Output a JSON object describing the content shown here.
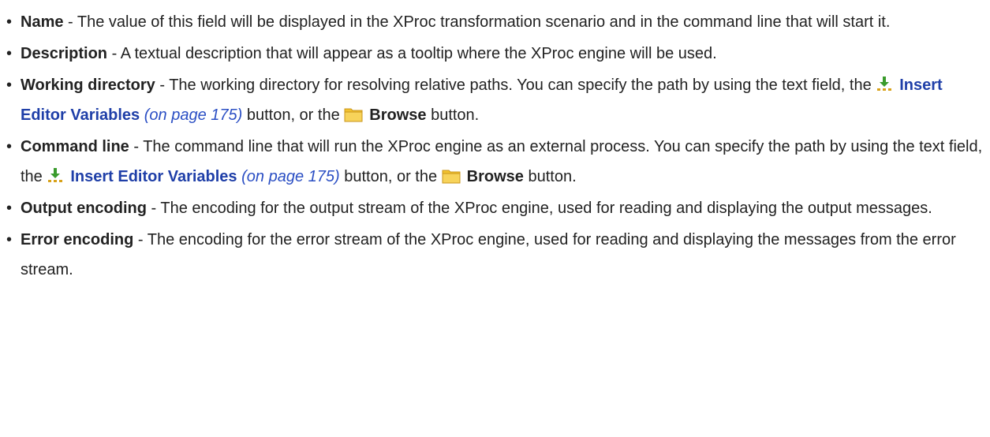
{
  "fields": [
    {
      "term": "Name",
      "desc": " - The value of this field will be displayed in the XProc transformation scenario and in the command line that will start it."
    },
    {
      "term": "Description",
      "desc": " - A textual description that will appear as a tooltip where the XProc engine will be used."
    },
    {
      "term": "Working directory",
      "desc": " - The working directory for resolving relative paths. You can specify the path by using the text field, the ",
      "insert_label": "Insert Editor Variables",
      "insert_ref": "(on page 175)",
      "mid_text": " button, or the ",
      "browse_label": "Browse",
      "end_text": " button."
    },
    {
      "term": "Command line",
      "desc": " - The command line that will run the XProc engine as an external process. You can specify the path by using the text field, the ",
      "insert_label": "Insert Editor Variables",
      "insert_ref": "(on page 175)",
      "mid_text": " button, or the ",
      "browse_label": "Browse",
      "end_text": " button."
    },
    {
      "term": "Output encoding",
      "desc": " - The encoding for the output stream of the XProc engine, used for reading and displaying the output messages."
    },
    {
      "term": "Error encoding",
      "desc": " - The encoding for the error stream of the XProc engine, used for reading and displaying the messages from the error stream."
    }
  ],
  "icons": {
    "insert": "insert-editor-variables-icon",
    "browse": "folder-icon"
  },
  "colors": {
    "link": "#1f3fa8",
    "xref": "#2b4fc4",
    "text": "#222222",
    "folder": "#f2c230",
    "arrow": "#3a9b2c"
  },
  "bullet": "•"
}
